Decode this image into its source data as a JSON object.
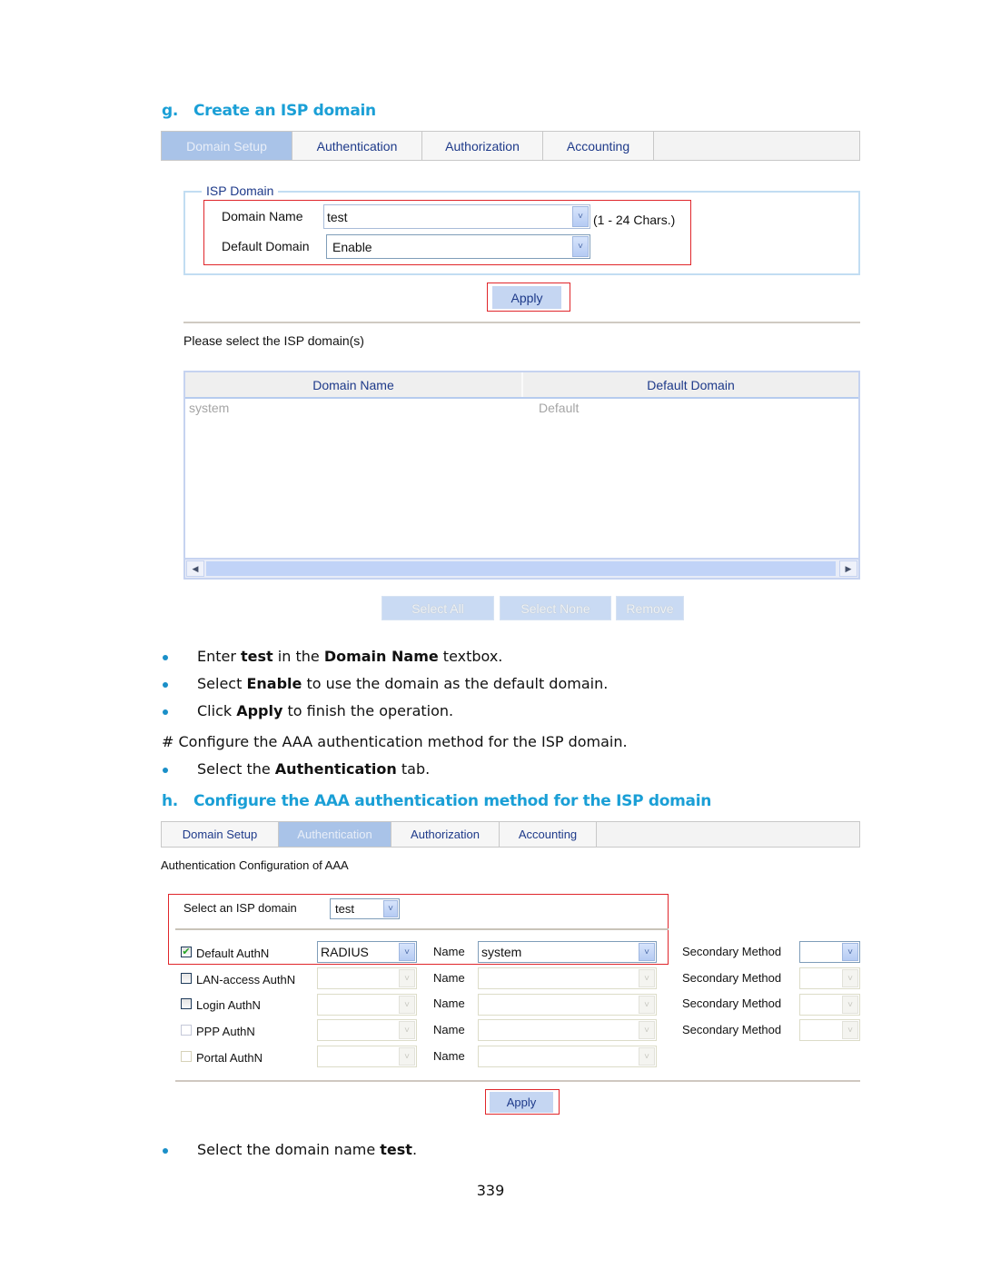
{
  "section_g": {
    "letter": "g.",
    "title": "Create an ISP domain",
    "tabs": [
      {
        "label": "Domain Setup",
        "active": true
      },
      {
        "label": "Authentication",
        "active": false
      },
      {
        "label": "Authorization",
        "active": false
      },
      {
        "label": "Accounting",
        "active": false
      }
    ],
    "fieldset_legend": "ISP Domain",
    "domain_name_label": "Domain Name",
    "domain_name_value": "test",
    "domain_name_hint": "(1 - 24 Chars.)",
    "default_domain_label": "Default Domain",
    "default_domain_value": "Enable",
    "apply_label": "Apply",
    "list_prompt": "Please select the ISP domain(s)",
    "table": {
      "columns": [
        "Domain Name",
        "Default Domain"
      ],
      "rows": [
        [
          "system",
          "Default"
        ]
      ]
    },
    "buttons": {
      "select_all": "Select All",
      "select_none": "Select None",
      "remove": "Remove"
    }
  },
  "instructions": {
    "bullets_1": [
      {
        "pre": "Enter ",
        "bold": "test",
        "mid": " in the ",
        "bold2": "Domain Name",
        "post": " textbox."
      },
      {
        "pre": "Select ",
        "bold": "Enable",
        "post": " to use the domain as the default domain."
      },
      {
        "pre": "Click ",
        "bold": "Apply",
        "post": " to finish the operation."
      }
    ],
    "comment": "# Configure the AAA authentication method for the ISP domain.",
    "bullet_tab": {
      "pre": "Select the ",
      "bold": "Authentication",
      "post": " tab."
    }
  },
  "section_h": {
    "letter": "h.",
    "title": "Configure the AAA authentication method for the ISP domain",
    "tabs": [
      {
        "label": "Domain Setup",
        "active": false
      },
      {
        "label": "Authentication",
        "active": true
      },
      {
        "label": "Authorization",
        "active": false
      },
      {
        "label": "Accounting",
        "active": false
      }
    ],
    "config_title": "Authentication Configuration of AAA",
    "select_domain_label": "Select an ISP domain",
    "select_domain_value": "test",
    "rows": [
      {
        "label": "Default AuthN",
        "checked": true,
        "method": "RADIUS",
        "name_label": "Name",
        "name_value": "system",
        "secondary_label": "Secondary Method",
        "secondary_value": ""
      },
      {
        "label": "LAN-access AuthN",
        "checked": false,
        "method": "",
        "name_label": "Name",
        "name_value": "",
        "secondary_label": "Secondary Method",
        "secondary_value": ""
      },
      {
        "label": "Login AuthN",
        "checked": false,
        "method": "",
        "name_label": "Name",
        "name_value": "",
        "secondary_label": "Secondary Method",
        "secondary_value": ""
      },
      {
        "label": "PPP AuthN",
        "checked": false,
        "method": "",
        "name_label": "Name",
        "name_value": "",
        "secondary_label": "Secondary Method",
        "secondary_value": ""
      },
      {
        "label": "Portal AuthN",
        "checked": false,
        "method": "",
        "name_label": "Name",
        "name_value": ""
      }
    ],
    "apply_label": "Apply"
  },
  "final_bullet": {
    "pre": "Select the domain name ",
    "bold": "test",
    "post": "."
  },
  "page_number": "339",
  "icons": {
    "dropdown_arrow": "˅",
    "check": "✔",
    "scroll_left": "◀",
    "scroll_right": "▶"
  }
}
